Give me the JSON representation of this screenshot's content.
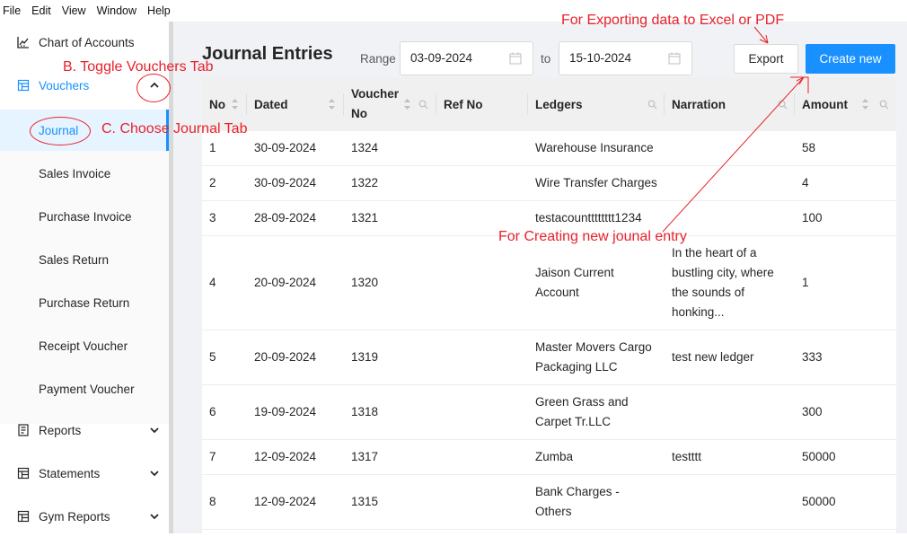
{
  "menubar": {
    "items": [
      "File",
      "Edit",
      "View",
      "Window",
      "Help"
    ]
  },
  "sidebar": {
    "chart_of_accounts": "Chart of Accounts",
    "vouchers": "Vouchers",
    "submenu": [
      "Journal",
      "Sales Invoice",
      "Purchase Invoice",
      "Sales Return",
      "Purchase Return",
      "Receipt Voucher",
      "Payment Voucher"
    ],
    "reports": "Reports",
    "statements": "Statements",
    "gym_reports": "Gym Reports"
  },
  "header": {
    "title": "Journal Entries",
    "range_label": "Range",
    "start_date": "03-09-2024",
    "to_label": "to",
    "end_date": "15-10-2024",
    "export_label": "Export",
    "create_label": "Create new"
  },
  "table": {
    "columns": {
      "no": "No",
      "dated": "Dated",
      "voucher_no_1": "Voucher",
      "voucher_no_2": "No",
      "ref_no": "Ref No",
      "ledgers": "Ledgers",
      "narration": "Narration",
      "amount": "Amount"
    },
    "rows": [
      {
        "no": "1",
        "dated": "30-09-2024",
        "voucher": "1324",
        "ledger1": "Warehouse Insurance",
        "ledger2": "",
        "narr": [
          "",
          "",
          "",
          ""
        ],
        "amount": "58"
      },
      {
        "no": "2",
        "dated": "30-09-2024",
        "voucher": "1322",
        "ledger1": "Wire Transfer Charges",
        "ledger2": "",
        "narr": [
          "",
          "",
          "",
          ""
        ],
        "amount": "4"
      },
      {
        "no": "3",
        "dated": "28-09-2024",
        "voucher": "1321",
        "ledger1": "testacountttttttt1234",
        "ledger2": "",
        "narr": [
          "",
          "",
          "",
          ""
        ],
        "amount": "100"
      },
      {
        "no": "4",
        "dated": "20-09-2024",
        "voucher": "1320",
        "ledger1": "Jaison Current",
        "ledger2": "Account",
        "narr": [
          "In the heart of a",
          "bustling city, where",
          "the sounds of",
          "honking..."
        ],
        "amount": "1"
      },
      {
        "no": "5",
        "dated": "20-09-2024",
        "voucher": "1319",
        "ledger1": "Master Movers Cargo",
        "ledger2": "Packaging LLC",
        "narr": [
          "test new ledger",
          "",
          "",
          ""
        ],
        "amount": "333"
      },
      {
        "no": "6",
        "dated": "19-09-2024",
        "voucher": "1318",
        "ledger1": "Green Grass and",
        "ledger2": "Carpet Tr.LLC",
        "narr": [
          "",
          "",
          "",
          ""
        ],
        "amount": "300"
      },
      {
        "no": "7",
        "dated": "12-09-2024",
        "voucher": "1317",
        "ledger1": "Zumba",
        "ledger2": "",
        "narr": [
          "testttt",
          "",
          "",
          ""
        ],
        "amount": "50000"
      },
      {
        "no": "8",
        "dated": "12-09-2024",
        "voucher": "1315",
        "ledger1": "Bank Charges -",
        "ledger2": "Others",
        "narr": [
          "",
          "",
          "",
          ""
        ],
        "amount": "50000"
      }
    ]
  },
  "annotations": {
    "export": "For Exporting data to Excel or PDF",
    "toggle": "B. Toggle Vouchers Tab",
    "choose": "C. Choose Journal Tab",
    "create": "For Creating new jounal entry"
  },
  "colors": {
    "primary": "#1890ff",
    "annotation": "#e8212b"
  }
}
